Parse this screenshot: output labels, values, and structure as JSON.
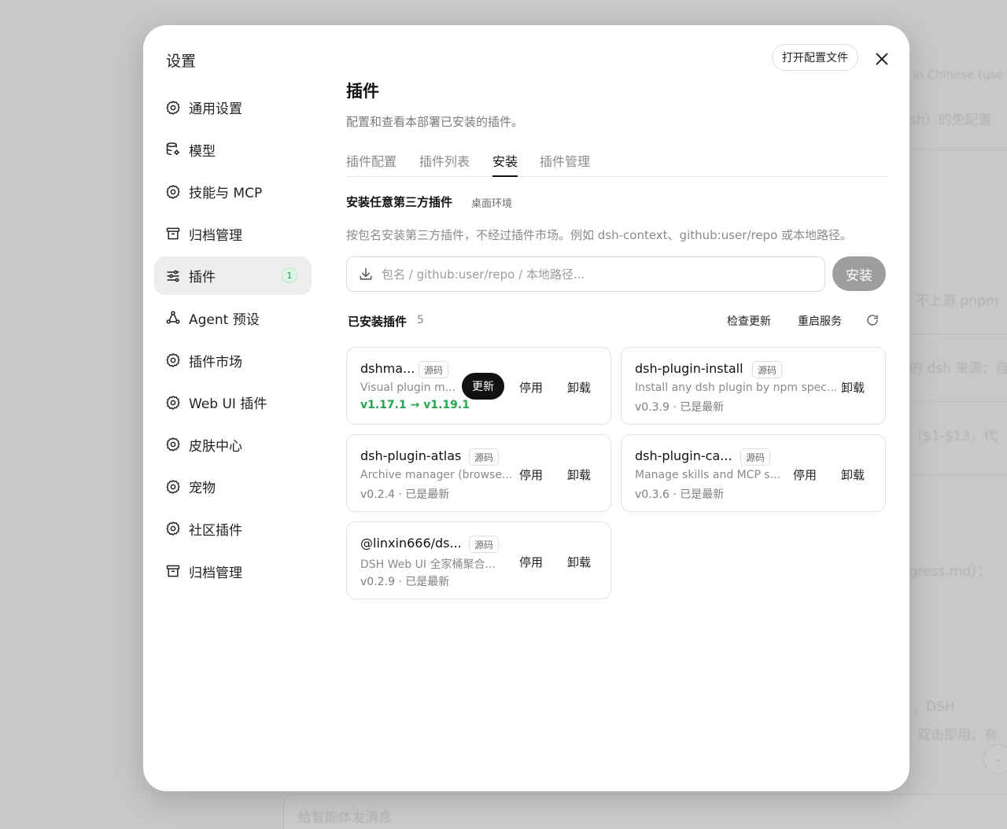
{
  "background": {
    "snippets": [
      "in Chinese (use",
      "sh）的免配置",
      "不上游 pnpm",
      "的 dsh 来源：自",
      "（$1-$13，代",
      "gress.md）：",
      "，DSH",
      "双击即用。有",
      "给智能体发消息"
    ]
  },
  "settings": {
    "title": "设置",
    "open_config_label": "打开配置文件",
    "nav": [
      {
        "label": "通用设置",
        "icon": "gear-icon"
      },
      {
        "label": "模型",
        "icon": "database-gear-icon"
      },
      {
        "label": "技能与 MCP",
        "icon": "gear-icon"
      },
      {
        "label": "归档管理",
        "icon": "archive-icon"
      },
      {
        "label": "插件",
        "icon": "sliders-icon",
        "badge": "1",
        "active": true
      },
      {
        "label": "Agent 预设",
        "icon": "share-nodes-icon"
      },
      {
        "label": "插件市场",
        "icon": "gear-icon"
      },
      {
        "label": "Web UI 插件",
        "icon": "gear-icon"
      },
      {
        "label": "皮肤中心",
        "icon": "gear-icon"
      },
      {
        "label": "宠物",
        "icon": "gear-icon"
      },
      {
        "label": "社区插件",
        "icon": "gear-icon"
      },
      {
        "label": "归档管理",
        "icon": "archive-icon"
      }
    ]
  },
  "page": {
    "title": "插件",
    "subtitle": "配置和查看本部署已安装的插件。",
    "tabs": [
      {
        "label": "插件配置"
      },
      {
        "label": "插件列表"
      },
      {
        "label": "安装",
        "active": true
      },
      {
        "label": "插件管理"
      }
    ]
  },
  "install": {
    "title": "安装任意第三方插件",
    "tag": "桌面环境",
    "description": "按包名安装第三方插件，不经过插件市场。例如 dsh-context、github:user/repo 或本地路径。",
    "placeholder": "包名 / github:user/repo / 本地路径...",
    "value": "",
    "button_label": "安装"
  },
  "installed": {
    "title": "已安装插件",
    "count": "5",
    "check_updates_label": "检查更新",
    "restart_label": "重启服务",
    "source_label": "源码",
    "disable_label": "停用",
    "uninstall_label": "卸载",
    "update_label": "更新",
    "plugins": [
      {
        "name": "dshma...",
        "description": "Visual plugin m...",
        "version": "v1.17.1 → v1.19.1",
        "has_update": true
      },
      {
        "name": "dsh-plugin-install",
        "description": "Install any dsh plugin by npm spec...",
        "version": "v0.3.9 · 已是最新"
      },
      {
        "name": "dsh-plugin-atlas",
        "description": "Archive manager (browse...",
        "version": "v0.2.4 · 已是最新"
      },
      {
        "name": "dsh-plugin-ca...",
        "description": "Manage skills and MCP s...",
        "version": "v0.3.6 · 已是最新"
      },
      {
        "name": "@linxin666/ds...",
        "description": "DSH Web UI 全家桶聚合...",
        "version": "v0.2.9 · 已是最新"
      }
    ]
  },
  "colors": {
    "accent_dark": "#111111",
    "update_green": "#22a84a",
    "badge_green_bg": "#dcf5e4",
    "disabled_button": "#9e9e9e"
  }
}
